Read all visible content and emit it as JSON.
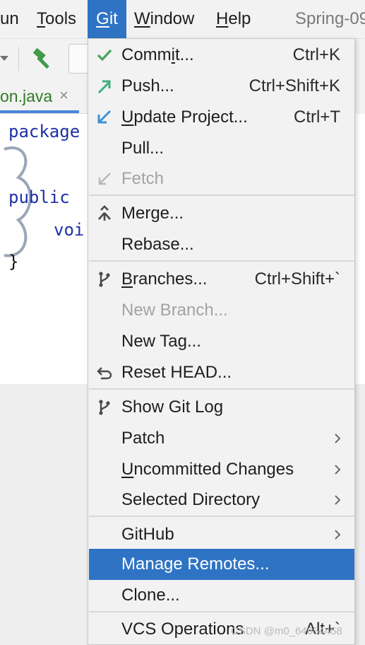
{
  "menubar": {
    "items": [
      {
        "pre": "",
        "mn": "",
        "post": "un"
      },
      {
        "pre": "",
        "mn": "T",
        "post": "ools"
      },
      {
        "pre": "",
        "mn": "G",
        "post": "it"
      },
      {
        "pre": "",
        "mn": "W",
        "post": "indow"
      },
      {
        "pre": "",
        "mn": "H",
        "post": "elp"
      }
    ],
    "title": "Spring-09"
  },
  "editor": {
    "tab_label": "on.java",
    "tab_close": "×",
    "lines": [
      "package",
      "public",
      "voi",
      "}"
    ]
  },
  "git_menu": {
    "items": [
      {
        "icon": "checkmark-icon",
        "pre": "Comm",
        "mn": "i",
        "post": "t...",
        "shortcut": "Ctrl+K"
      },
      {
        "icon": "push-arrow-icon",
        "pre": "Push...",
        "mn": "",
        "post": "",
        "shortcut": "Ctrl+Shift+K"
      },
      {
        "icon": "update-arrow-icon",
        "pre": "",
        "mn": "U",
        "post": "pdate Project...",
        "shortcut": "Ctrl+T"
      },
      {
        "icon": "",
        "pre": "Pull...",
        "mn": "",
        "post": "",
        "shortcut": ""
      },
      {
        "icon": "fetch-icon",
        "pre": "Fetch",
        "mn": "",
        "post": "",
        "shortcut": ""
      },
      {
        "icon": "merge-icon",
        "pre": "Merge...",
        "mn": "",
        "post": "",
        "shortcut": ""
      },
      {
        "icon": "",
        "pre": "Rebase...",
        "mn": "",
        "post": "",
        "shortcut": ""
      },
      {
        "icon": "branch-icon",
        "pre": "",
        "mn": "B",
        "post": "ranches...",
        "shortcut": "Ctrl+Shift+`"
      },
      {
        "icon": "",
        "pre": "New Branch...",
        "mn": "",
        "post": "",
        "shortcut": ""
      },
      {
        "icon": "",
        "pre": "New Tag...",
        "mn": "",
        "post": "",
        "shortcut": ""
      },
      {
        "icon": "reset-icon",
        "pre": "Reset HEAD...",
        "mn": "",
        "post": "",
        "shortcut": ""
      },
      {
        "icon": "git-log-icon",
        "pre": "Show Git Log",
        "mn": "",
        "post": "",
        "shortcut": ""
      },
      {
        "icon": "",
        "pre": "Patch",
        "mn": "",
        "post": "",
        "shortcut": ""
      },
      {
        "icon": "",
        "pre": "",
        "mn": "U",
        "post": "ncommitted Changes",
        "shortcut": ""
      },
      {
        "icon": "",
        "pre": "Selected Directory",
        "mn": "",
        "post": "",
        "shortcut": ""
      },
      {
        "icon": "",
        "pre": "GitHub",
        "mn": "",
        "post": "",
        "shortcut": ""
      },
      {
        "icon": "",
        "pre": "Manage Remotes...",
        "mn": "",
        "post": "",
        "shortcut": ""
      },
      {
        "icon": "",
        "pre": "Clone...",
        "mn": "",
        "post": "",
        "shortcut": ""
      },
      {
        "icon": "",
        "pre": "VCS Operations",
        "mn": "",
        "post": "",
        "shortcut": "Alt+`"
      }
    ]
  },
  "watermark": "CSDN @m0_64654458",
  "colors": {
    "accent": "#2f74c4",
    "success": "#4aa35a",
    "push_arrow": "#3fae7c",
    "update_arrow": "#3c91d8",
    "tab_text": "#2f7b26",
    "disabled_text": "#a3a3a3"
  }
}
